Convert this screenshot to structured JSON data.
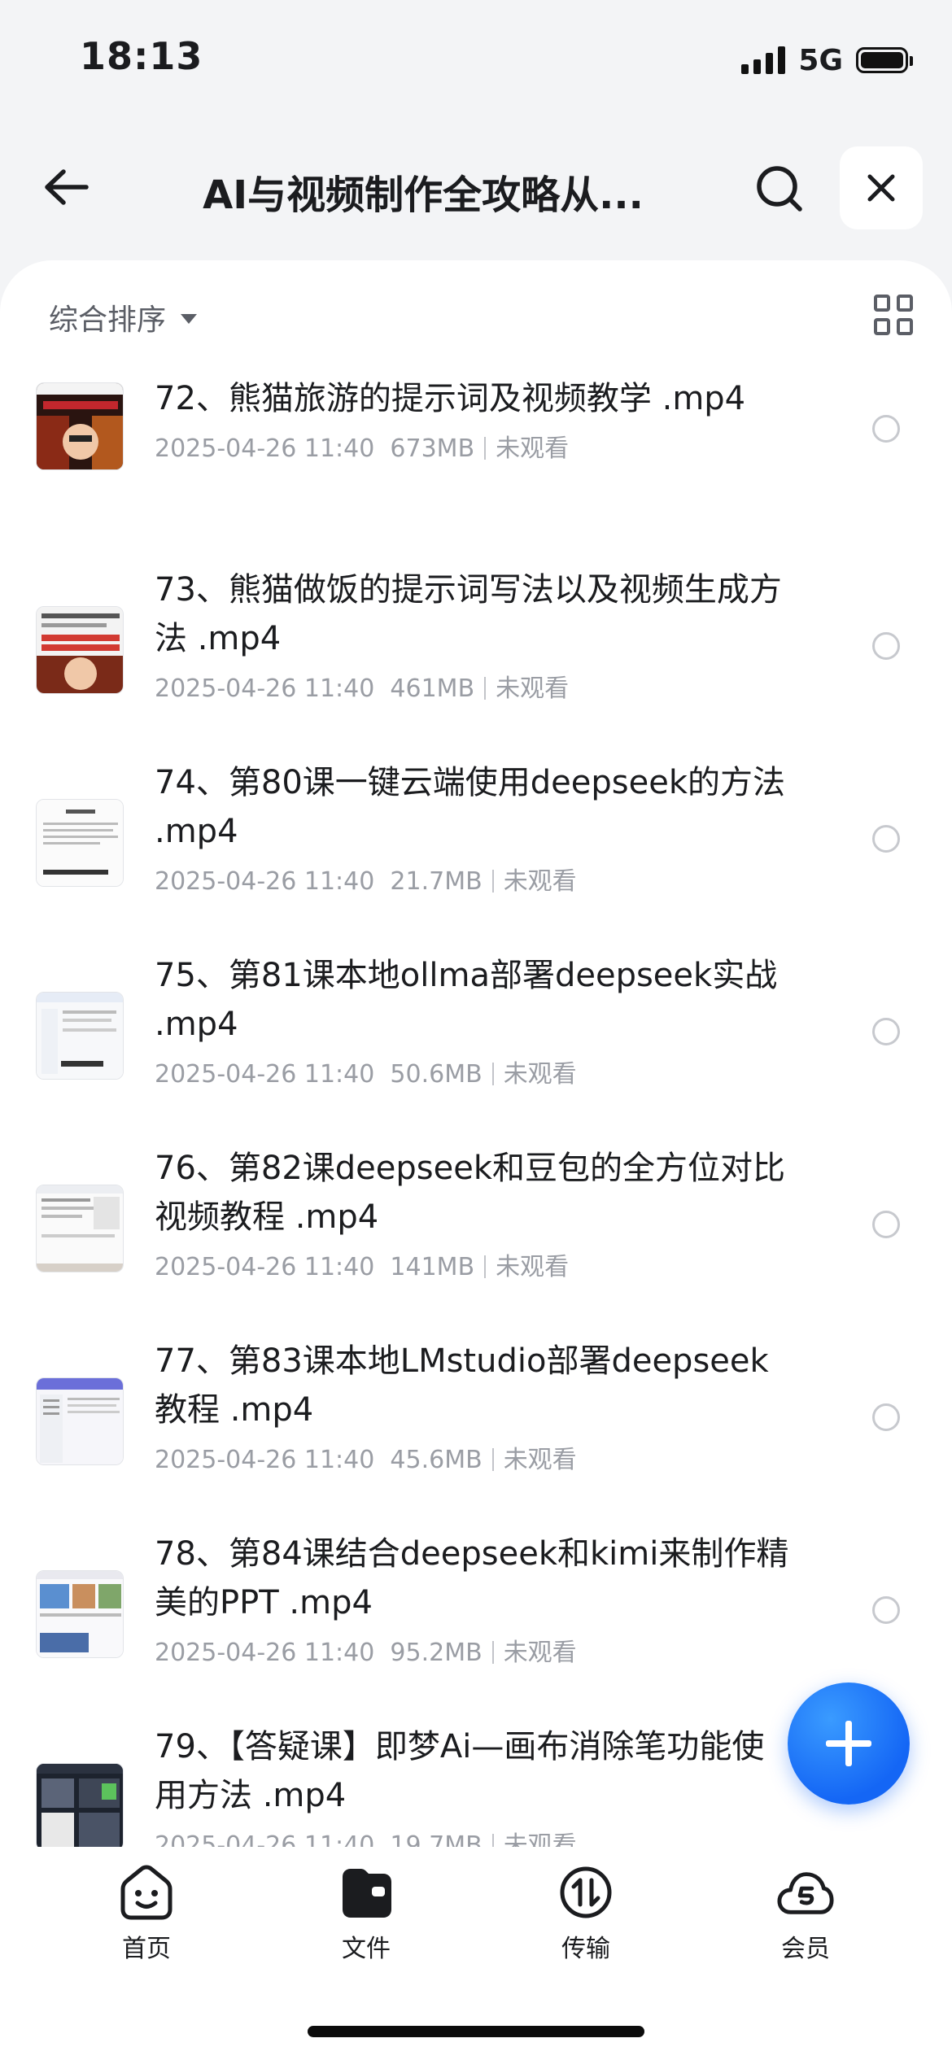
{
  "status_bar": {
    "time": "18:13",
    "network": "5G"
  },
  "header": {
    "title": "AI与视频制作全攻略从..."
  },
  "toolbar": {
    "sort_label": "综合排序"
  },
  "files": [
    {
      "title": "72、熊猫旅游的提示词及视频教学 .mp4",
      "date": "2025-04-26 11:40",
      "size": "673MB",
      "status": "未观看",
      "thumb_accent": "#c2272d"
    },
    {
      "title": "73、熊猫做饭的提示词写法以及视频生成方法 .mp4",
      "date": "2025-04-26 11:40",
      "size": "461MB",
      "status": "未观看",
      "thumb_accent": "#d23a32"
    },
    {
      "title": "74、第80课一键云端使用deepseek的方法 .mp4",
      "date": "2025-04-26 11:40",
      "size": "21.7MB",
      "status": "未观看",
      "thumb_accent": "#e7e9ee"
    },
    {
      "title": "75、第81课本地ollma部署deepseek实战 .mp4",
      "date": "2025-04-26 11:40",
      "size": "50.6MB",
      "status": "未观看",
      "thumb_accent": "#e6ecf6"
    },
    {
      "title": "76、第82课deepseek和豆包的全方位对比视频教程 .mp4",
      "date": "2025-04-26 11:40",
      "size": "141MB",
      "status": "未观看",
      "thumb_accent": "#eceef2"
    },
    {
      "title": "77、第83课本地LMstudio部署deepseek教程 .mp4",
      "date": "2025-04-26 11:40",
      "size": "45.6MB",
      "status": "未观看",
      "thumb_accent": "#6b6fd9"
    },
    {
      "title": "78、第84课结合deepseek和kimi来制作精美的PPT .mp4",
      "date": "2025-04-26 11:40",
      "size": "95.2MB",
      "status": "未观看",
      "thumb_accent": "#5a8fd0"
    },
    {
      "title": "79、【答疑课】即梦Ai—画布消除笔功能使用方法 .mp4",
      "date": "2025-04-26 11:40",
      "size": "19.7MB",
      "status": "未观看",
      "thumb_accent": "#2b3240"
    }
  ],
  "tabs": [
    {
      "label": "首页",
      "icon": "home-face-icon"
    },
    {
      "label": "文件",
      "icon": "folder-icon"
    },
    {
      "label": "传输",
      "icon": "transfer-icon"
    },
    {
      "label": "会员",
      "icon": "vip-cloud-icon"
    }
  ],
  "colors": {
    "accent": "#1466f5",
    "text": "#1b1c1f",
    "meta": "#9a9da4"
  }
}
